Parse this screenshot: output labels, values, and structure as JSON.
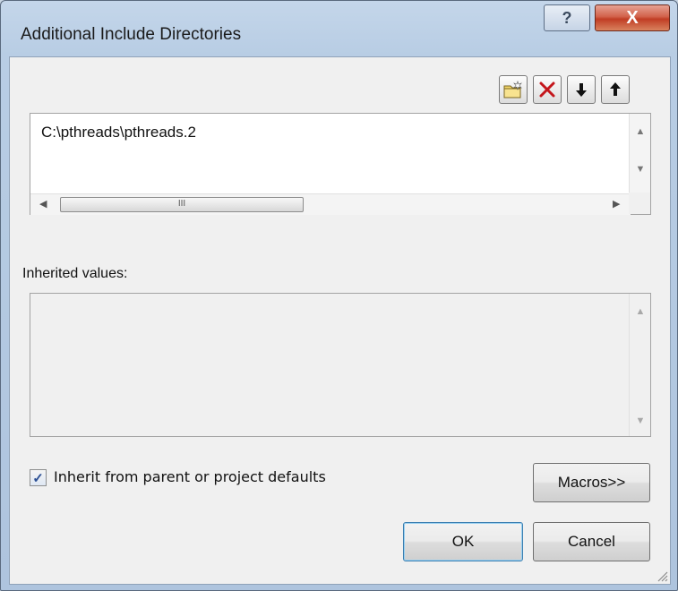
{
  "dialog": {
    "title": "Additional Include Directories",
    "help_glyph": "?",
    "close_glyph": "X"
  },
  "toolbar": {
    "new_line_icon": "folder-new-icon",
    "delete_icon": "delete-x-icon",
    "move_down_icon": "arrow-down-icon",
    "move_up_icon": "arrow-up-icon"
  },
  "directories": {
    "items": [
      "C:\\pthreads\\pthreads.2"
    ],
    "hscroll_thumb_label": "III"
  },
  "inherited": {
    "label": "Inherited values:",
    "items": []
  },
  "inherit_checkbox": {
    "label": "Inherit from parent or project defaults",
    "checked": true
  },
  "buttons": {
    "macros": "Macros>>",
    "ok": "OK",
    "cancel": "Cancel"
  }
}
